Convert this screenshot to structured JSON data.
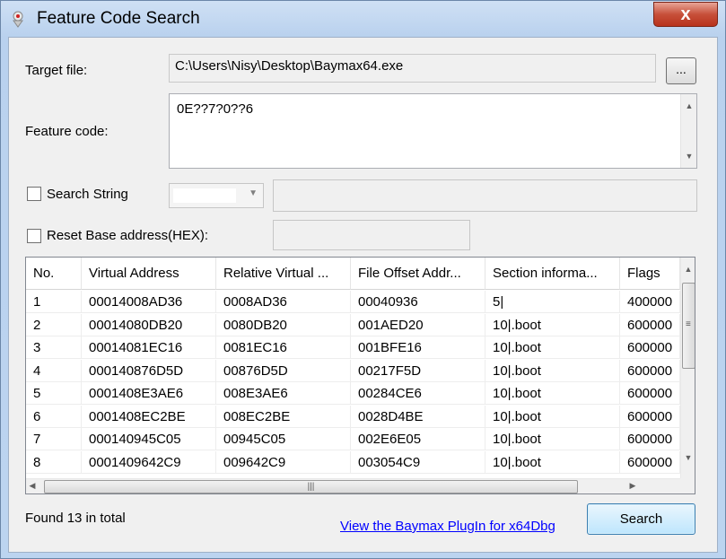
{
  "window": {
    "title": "Feature Code Search",
    "close_glyph": "x"
  },
  "target_file": {
    "label": "Target file:",
    "value": "C:\\Users\\Nisy\\Desktop\\Baymax64.exe",
    "browse_label": "..."
  },
  "feature_code": {
    "label": "Feature code:",
    "value": "0E??7?0??6"
  },
  "search_string": {
    "label": "Search String",
    "checked": false
  },
  "reset_base": {
    "label": "Reset Base address(HEX):",
    "checked": false
  },
  "results": {
    "columns": [
      "No.",
      "Virtual Address",
      "Relative Virtual ...",
      "File Offset Addr...",
      "Section informa...",
      "Flags"
    ],
    "rows": [
      [
        "1",
        "00014008AD36",
        "0008AD36",
        "00040936",
        "5|",
        "400000"
      ],
      [
        "2",
        "00014080DB20",
        "0080DB20",
        "001AED20",
        "10|.boot",
        "600000"
      ],
      [
        "3",
        "00014081EC16",
        "0081EC16",
        "001BFE16",
        "10|.boot",
        "600000"
      ],
      [
        "4",
        "000140876D5D",
        "00876D5D",
        "00217F5D",
        "10|.boot",
        "600000"
      ],
      [
        "5",
        "0001408E3AE6",
        "008E3AE6",
        "00284CE6",
        "10|.boot",
        "600000"
      ],
      [
        "6",
        "0001408EC2BE",
        "008EC2BE",
        "0028D4BE",
        "10|.boot",
        "600000"
      ],
      [
        "7",
        "000140945C05",
        "00945C05",
        "002E6E05",
        "10|.boot",
        "600000"
      ],
      [
        "8",
        "0001409642C9",
        "009642C9",
        "003054C9",
        "10|.boot",
        "600000"
      ]
    ]
  },
  "footer": {
    "status": "Found 13 in total",
    "link_text": "View the Baymax PlugIn for x64Dbg",
    "search_label": "Search"
  },
  "icons": {
    "app": "app-icon",
    "close": "close-icon",
    "scroll_up": "scroll-up-icon",
    "scroll_down": "scroll-down-icon",
    "scroll_left": "scroll-left-icon",
    "scroll_right": "scroll-right-icon",
    "dropdown": "chevron-down-icon"
  },
  "colors": {
    "title_gradient": "#bcd4f0",
    "close_button": "#c7503a",
    "link": "#0000ff",
    "search_button": "#bee6fd"
  }
}
